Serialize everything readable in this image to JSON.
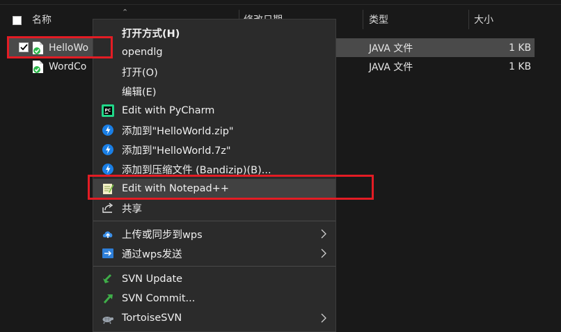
{
  "columns": {
    "name": "名称",
    "date": "修改日期",
    "type": "类型",
    "size": "大小"
  },
  "files": [
    {
      "name": "HelloWo",
      "type": "JAVA 文件",
      "size": "1 KB",
      "selected": true
    },
    {
      "name": "WordCo",
      "type": "JAVA 文件",
      "size": "1 KB",
      "selected": false
    }
  ],
  "context_menu": {
    "items": [
      {
        "label": "打开方式(H)",
        "icon": "none",
        "bold": true
      },
      {
        "label": "opendlg",
        "icon": "none"
      },
      {
        "label": "打开(O)",
        "icon": "none"
      },
      {
        "label": "编辑(E)",
        "icon": "none"
      },
      {
        "label": "Edit with PyCharm",
        "icon": "pycharm-icon"
      },
      {
        "label": "添加到\"HelloWorld.zip\"",
        "icon": "bandizip-icon"
      },
      {
        "label": "添加到\"HelloWorld.7z\"",
        "icon": "bandizip-icon"
      },
      {
        "label": "添加到压缩文件 (Bandizip)(B)...",
        "icon": "bandizip-icon"
      },
      {
        "label": "Edit with Notepad++",
        "icon": "notepadpp-icon",
        "highlighted": true
      },
      {
        "label": "共享",
        "icon": "share-icon"
      },
      {
        "label": "上传或同步到wps",
        "icon": "wps-upload-icon",
        "submenu": true
      },
      {
        "label": "通过wps发送",
        "icon": "wps-send-icon",
        "submenu": true
      },
      {
        "label": "SVN Update",
        "icon": "svn-update-icon"
      },
      {
        "label": "SVN Commit...",
        "icon": "svn-commit-icon"
      },
      {
        "label": "TortoiseSVN",
        "icon": "tortoisesvn-icon",
        "submenu": true
      }
    ]
  },
  "colors": {
    "background": "#191919",
    "menu_background": "#2b2b2b",
    "selection": "#4a4a4a",
    "highlight_box": "#e31c24"
  }
}
